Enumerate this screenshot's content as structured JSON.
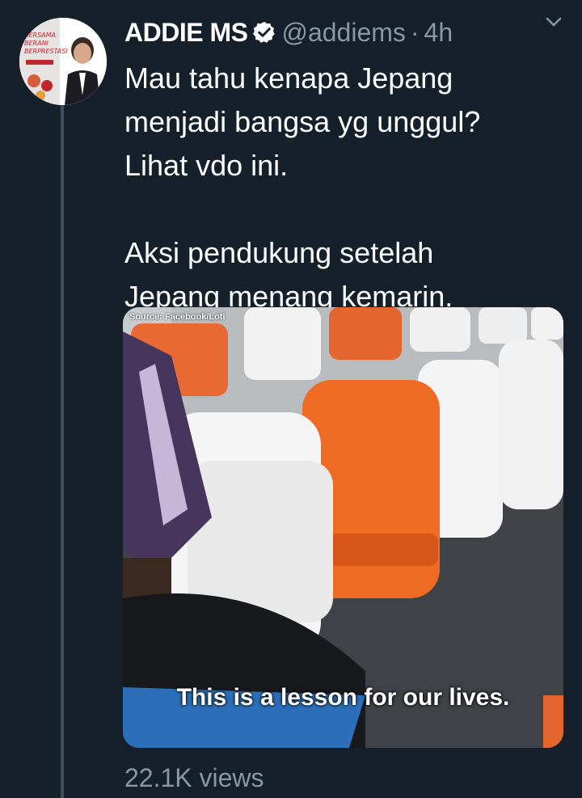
{
  "tweet": {
    "author_name": "ADDIE MS",
    "verified_icon": "verified-badge-icon",
    "handle": "@addiems",
    "separator": "·",
    "time": "4h",
    "menu_icon": "chevron-down-icon",
    "text_lines_1": [
      "Mau tahu kenapa Jepang",
      "menjadi bangsa yg unggul?",
      "Lihat vdo ini."
    ],
    "text_lines_2": [
      "Aksi pendukung setelah",
      "Jepang menang kemarin."
    ],
    "media": {
      "source": "Source: Facebook/Loti",
      "caption": "This is a lesson for our lives."
    },
    "views": "22.1K views"
  },
  "colors": {
    "background": "#15202b",
    "secondary_text": "#8899a6",
    "verified": "#ffffff",
    "thread_line": "#3d4f5e"
  }
}
